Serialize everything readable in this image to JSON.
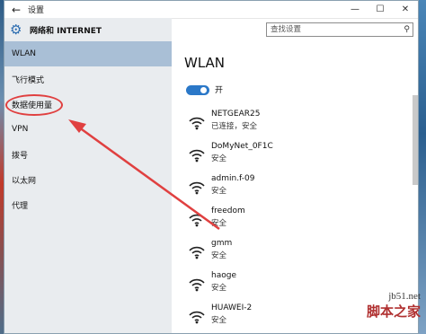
{
  "window": {
    "title": "设置"
  },
  "sidebar": {
    "header": "网络和 INTERNET",
    "items": [
      {
        "label": "WLAN",
        "active": true
      },
      {
        "label": "飞行模式"
      },
      {
        "label": "数据使用量"
      },
      {
        "label": "VPN"
      },
      {
        "label": "拨号"
      },
      {
        "label": "以太网"
      },
      {
        "label": "代理"
      }
    ]
  },
  "search": {
    "placeholder": "查找设置"
  },
  "main": {
    "title": "WLAN",
    "toggle_label": "开",
    "toggle_on": true,
    "networks": [
      {
        "name": "NETGEAR25",
        "status": "已连接，安全"
      },
      {
        "name": "DoMyNet_0F1C",
        "status": "安全"
      },
      {
        "name": "admin.f-09",
        "status": "安全"
      },
      {
        "name": "freedom",
        "status": "安全"
      },
      {
        "name": "gmm",
        "status": "安全"
      },
      {
        "name": "haoge",
        "status": "安全"
      },
      {
        "name": "HUAWEI-2",
        "status": "安全"
      }
    ]
  },
  "watermark": {
    "line1": "jb51.net",
    "line2": "脚本之家"
  },
  "colors": {
    "accent": "#2b78c8",
    "annotation": "#e04040",
    "sidebar_active": "#a9bfd6"
  }
}
